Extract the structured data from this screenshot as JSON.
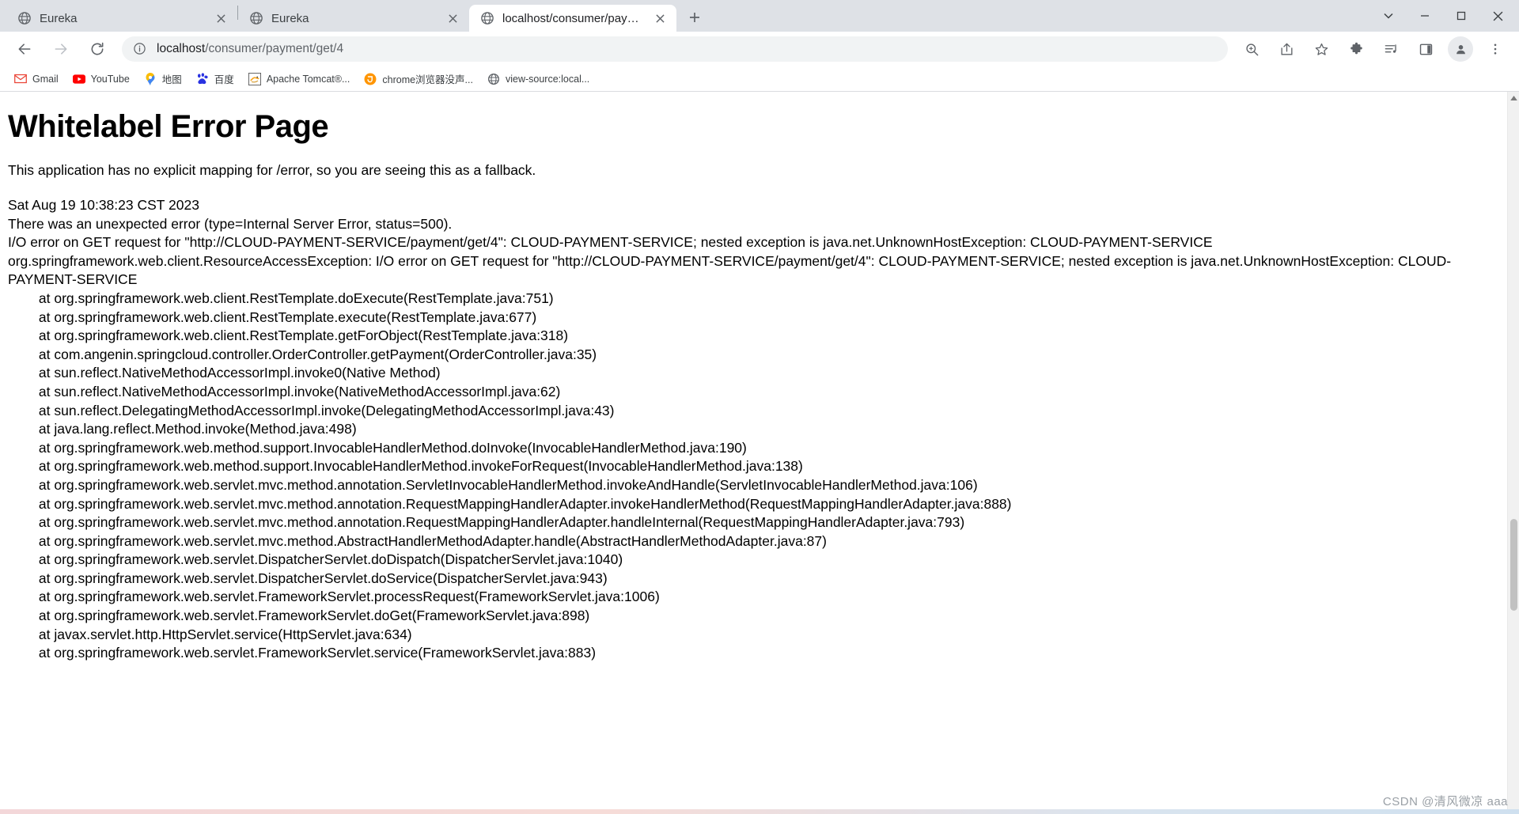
{
  "window": {
    "minimize_label": "Minimize",
    "maximize_label": "Maximize",
    "close_label": "Close",
    "tabsearch_label": "Search tabs"
  },
  "tabs": [
    {
      "title": "Eureka",
      "favicon": "globe-icon",
      "active": false,
      "close_label": "×"
    },
    {
      "title": "Eureka",
      "favicon": "globe-icon",
      "active": false,
      "close_label": "×"
    },
    {
      "title": "localhost/consumer/payment/",
      "favicon": "globe-icon",
      "active": true,
      "close_label": "×"
    }
  ],
  "newtab": {
    "label": "+",
    "name": "new-tab-button"
  },
  "toolbar": {
    "back_label": "←",
    "forward_label": "→",
    "reload_label": "↻",
    "site_info_label": "ⓘ",
    "url_host": "localhost",
    "url_path": "/consumer/payment/get/4",
    "url_full": "localhost/consumer/payment/get/4",
    "icons": [
      {
        "name": "zoom-icon",
        "glyph": "search-plus"
      },
      {
        "name": "share-icon",
        "glyph": "share"
      },
      {
        "name": "bookmark-star-icon",
        "glyph": "star"
      },
      {
        "name": "extensions-puzzle-icon",
        "glyph": "puzzle"
      },
      {
        "name": "media-playlist-icon",
        "glyph": "playlist"
      },
      {
        "name": "side-panel-icon",
        "glyph": "panel"
      },
      {
        "name": "profile-avatar-icon",
        "glyph": "avatar"
      },
      {
        "name": "chrome-menu-icon",
        "glyph": "kebab"
      }
    ]
  },
  "bookmarks": [
    {
      "label": "Gmail",
      "icon": "gmail-icon"
    },
    {
      "label": "YouTube",
      "icon": "youtube-icon"
    },
    {
      "label": "地图",
      "icon": "google-maps-pin-icon"
    },
    {
      "label": "百度",
      "icon": "baidu-icon"
    },
    {
      "label": "Apache Tomcat®...",
      "icon": "tomcat-icon"
    },
    {
      "label": "chrome浏览器没声...",
      "icon": "orange-circle-icon"
    },
    {
      "label": "view-source:local...",
      "icon": "globe-icon"
    }
  ],
  "page": {
    "title": "Whitelabel Error Page",
    "intro": "This application has no explicit mapping for /error, so you are seeing this as a fallback.",
    "timestamp": "Sat Aug 19 10:38:23 CST 2023",
    "error_summary": "There was an unexpected error (type=Internal Server Error, status=500).",
    "error_message": "I/O error on GET request for \"http://CLOUD-PAYMENT-SERVICE/payment/get/4\": CLOUD-PAYMENT-SERVICE; nested exception is java.net.UnknownHostException: CLOUD-PAYMENT-SERVICE",
    "exception_header": "org.springframework.web.client.ResourceAccessException: I/O error on GET request for \"http://CLOUD-PAYMENT-SERVICE/payment/get/4\": CLOUD-PAYMENT-SERVICE; nested exception is java.net.UnknownHostException: CLOUD-PAYMENT-SERVICE",
    "stack_trace": [
      "\tat org.springframework.web.client.RestTemplate.doExecute(RestTemplate.java:751)",
      "\tat org.springframework.web.client.RestTemplate.execute(RestTemplate.java:677)",
      "\tat org.springframework.web.client.RestTemplate.getForObject(RestTemplate.java:318)",
      "\tat com.angenin.springcloud.controller.OrderController.getPayment(OrderController.java:35)",
      "\tat sun.reflect.NativeMethodAccessorImpl.invoke0(Native Method)",
      "\tat sun.reflect.NativeMethodAccessorImpl.invoke(NativeMethodAccessorImpl.java:62)",
      "\tat sun.reflect.DelegatingMethodAccessorImpl.invoke(DelegatingMethodAccessorImpl.java:43)",
      "\tat java.lang.reflect.Method.invoke(Method.java:498)",
      "\tat org.springframework.web.method.support.InvocableHandlerMethod.doInvoke(InvocableHandlerMethod.java:190)",
      "\tat org.springframework.web.method.support.InvocableHandlerMethod.invokeForRequest(InvocableHandlerMethod.java:138)",
      "\tat org.springframework.web.servlet.mvc.method.annotation.ServletInvocableHandlerMethod.invokeAndHandle(ServletInvocableHandlerMethod.java:106)",
      "\tat org.springframework.web.servlet.mvc.method.annotation.RequestMappingHandlerAdapter.invokeHandlerMethod(RequestMappingHandlerAdapter.java:888)",
      "\tat org.springframework.web.servlet.mvc.method.annotation.RequestMappingHandlerAdapter.handleInternal(RequestMappingHandlerAdapter.java:793)",
      "\tat org.springframework.web.servlet.mvc.method.AbstractHandlerMethodAdapter.handle(AbstractHandlerMethodAdapter.java:87)",
      "\tat org.springframework.web.servlet.DispatcherServlet.doDispatch(DispatcherServlet.java:1040)",
      "\tat org.springframework.web.servlet.DispatcherServlet.doService(DispatcherServlet.java:943)",
      "\tat org.springframework.web.servlet.FrameworkServlet.processRequest(FrameworkServlet.java:1006)",
      "\tat org.springframework.web.servlet.FrameworkServlet.doGet(FrameworkServlet.java:898)",
      "\tat javax.servlet.http.HttpServlet.service(HttpServlet.java:634)",
      "\tat org.springframework.web.servlet.FrameworkServlet.service(FrameworkServlet.java:883)"
    ]
  },
  "watermark": "CSDN @清风微凉 aaa",
  "colors": {
    "tabstrip_bg": "#dee1e6",
    "omnibox_bg": "#f1f3f4",
    "text": "#202124",
    "muted": "#5f6368",
    "accent": "#1a73e8"
  }
}
